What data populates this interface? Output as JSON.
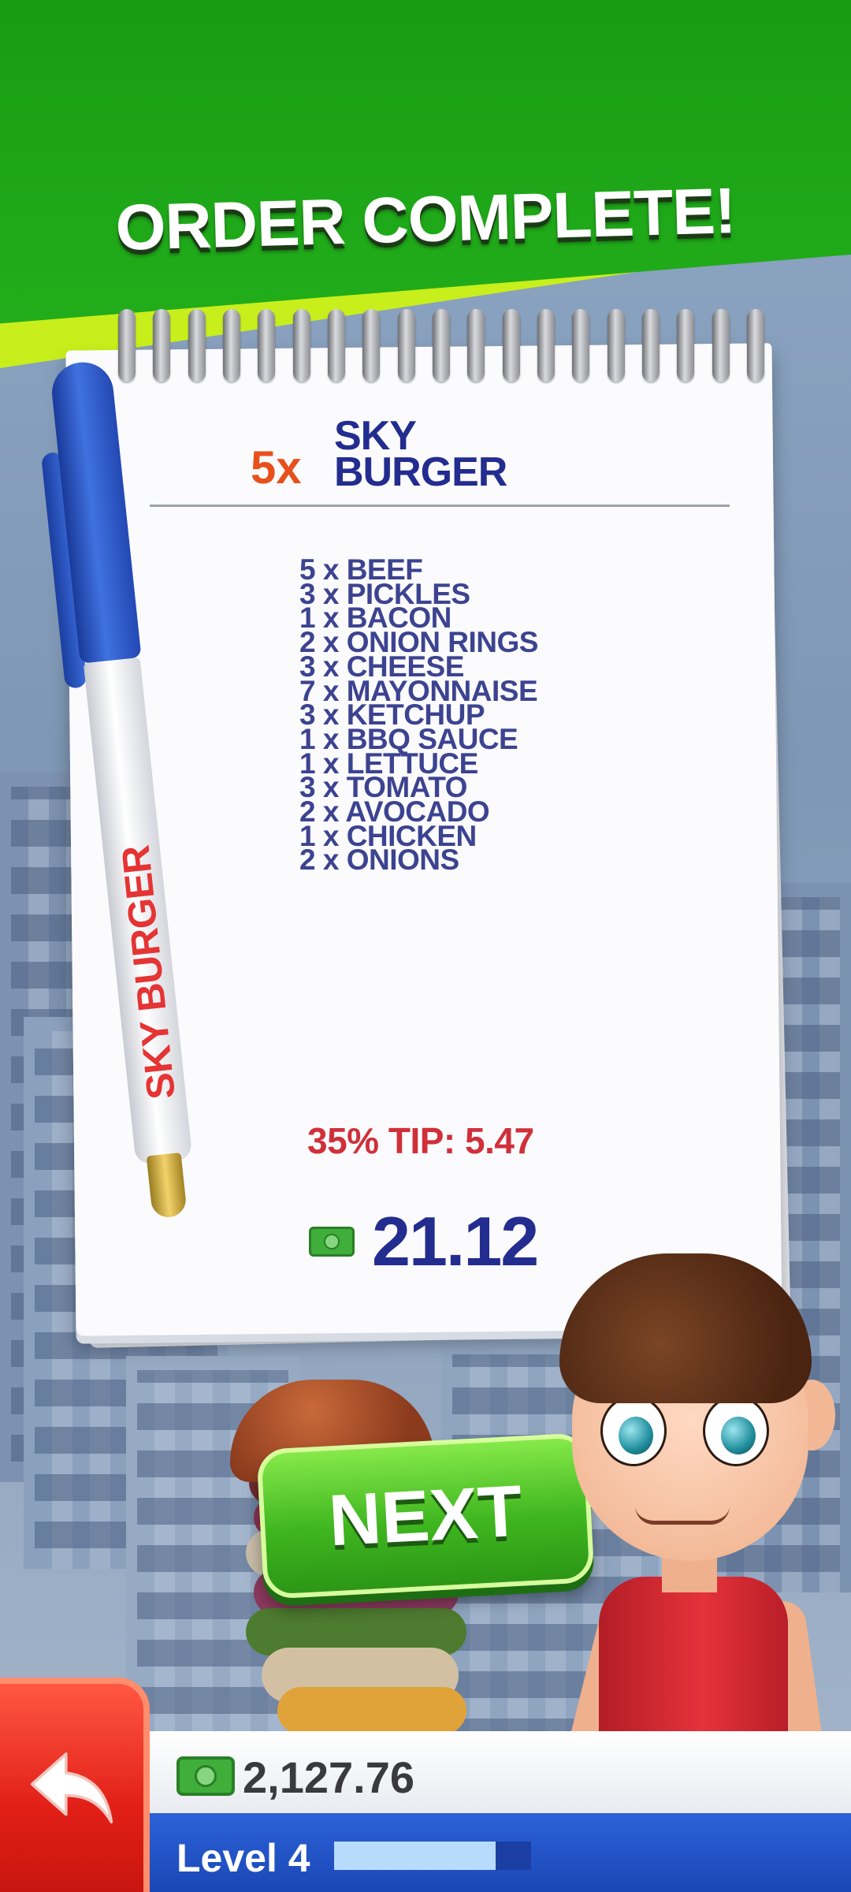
{
  "header": {
    "title": "ORDER COMPLETE!"
  },
  "order": {
    "quantity": "5x",
    "name": "SKY BURGER",
    "ingredients": [
      "5 x BEEF",
      "3 x PICKLES",
      "1 x BACON",
      "2 x ONION RINGS",
      "3 x CHEESE",
      "7 x MAYONNAISE",
      "3 x KETCHUP",
      "1 x BBQ SAUCE",
      "1 x LETTUCE",
      "3 x TOMATO",
      "2 x AVOCADO",
      "1 x CHICKEN",
      "2 x ONIONS"
    ],
    "tip_text": "35% TIP: 5.47",
    "total": "21.12"
  },
  "pen": {
    "brand": "SKY BURGER"
  },
  "buttons": {
    "next_label": "NEXT"
  },
  "hud": {
    "money": "2,127.76",
    "level_label": "Level 4",
    "level_progress": 0.82
  },
  "icons": {
    "cash": "cash-icon",
    "back": "back-arrow-icon"
  },
  "colors": {
    "banner_green": "#1ea718",
    "banner_lime": "#c8ef1b",
    "ink_blue": "#232c8f",
    "tip_red": "#d0303a",
    "qty_orange": "#e8501b",
    "next_green": "#3fb61f",
    "back_red": "#e11f17",
    "level_blue": "#1a47b6"
  }
}
